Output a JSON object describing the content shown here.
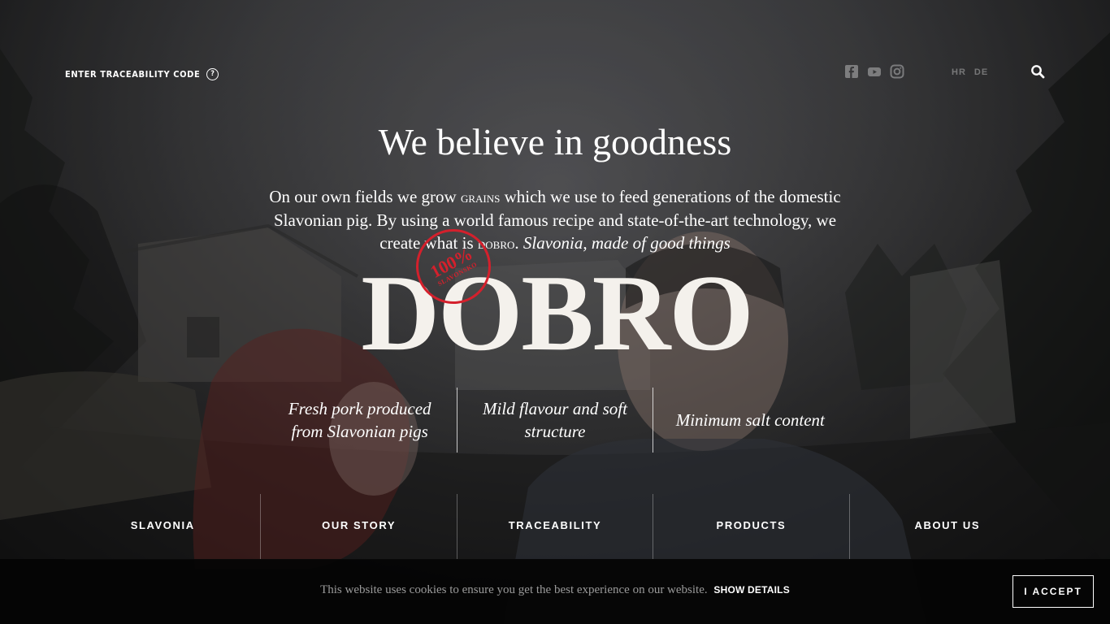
{
  "header": {
    "traceability_link": "ENTER TRACEABILITY CODE",
    "help_glyph": "?",
    "socials": [
      {
        "icon": "facebook-icon"
      },
      {
        "icon": "youtube-icon"
      },
      {
        "icon": "instagram-icon"
      }
    ],
    "languages": [
      "HR",
      "DE"
    ],
    "search_icon": "search-icon"
  },
  "hero": {
    "title": "We believe in goodness",
    "para_part1": "On our own fields we grow ",
    "para_grains": "grains",
    "para_part2": " which we use to feed generations of the domestic Slavonian pig. By using a world famous recipe and state-of-the-art technology, we create what is ",
    "para_dobro": "dobro",
    "para_part3": ". ",
    "para_tagline": "Slavonia, made of good things"
  },
  "logo": {
    "wordmark": "DOBRO",
    "stamp_percent": "100%",
    "stamp_text": "SLAVONSKO",
    "stamp_color": "#d4202c"
  },
  "features": [
    {
      "text": "Fresh pork produced from Slavonian pigs"
    },
    {
      "text": "Mild flavour and soft structure"
    },
    {
      "text": "Minimum salt content"
    }
  ],
  "nav": [
    {
      "label": "SLAVONIA"
    },
    {
      "label": "OUR STORY"
    },
    {
      "label": "TRACEABILITY"
    },
    {
      "label": "PRODUCTS"
    },
    {
      "label": "ABOUT US"
    }
  ],
  "cookie": {
    "message": "This website uses cookies to ensure you get the best experience on our website.",
    "details_link": "SHOW DETAILS",
    "accept_label": "I ACCEPT"
  }
}
